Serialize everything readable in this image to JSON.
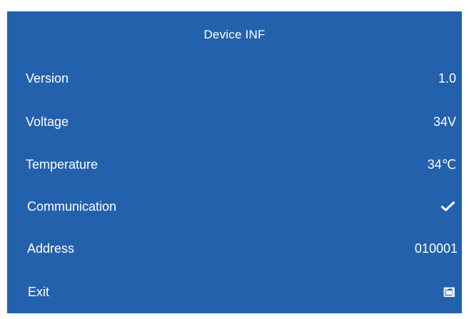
{
  "title": "Device INF",
  "rows": [
    {
      "label": "Version",
      "value": "1.0"
    },
    {
      "label": "Voltage",
      "value": "34V"
    },
    {
      "label": "Temperature",
      "value": "34℃"
    },
    {
      "label": "Communication",
      "icon": "check-icon"
    },
    {
      "label": "Address",
      "value": "010001"
    },
    {
      "label": "Exit",
      "icon": "exit-icon"
    }
  ],
  "colors": {
    "background": "#2461ad",
    "text": "#ffffff"
  }
}
